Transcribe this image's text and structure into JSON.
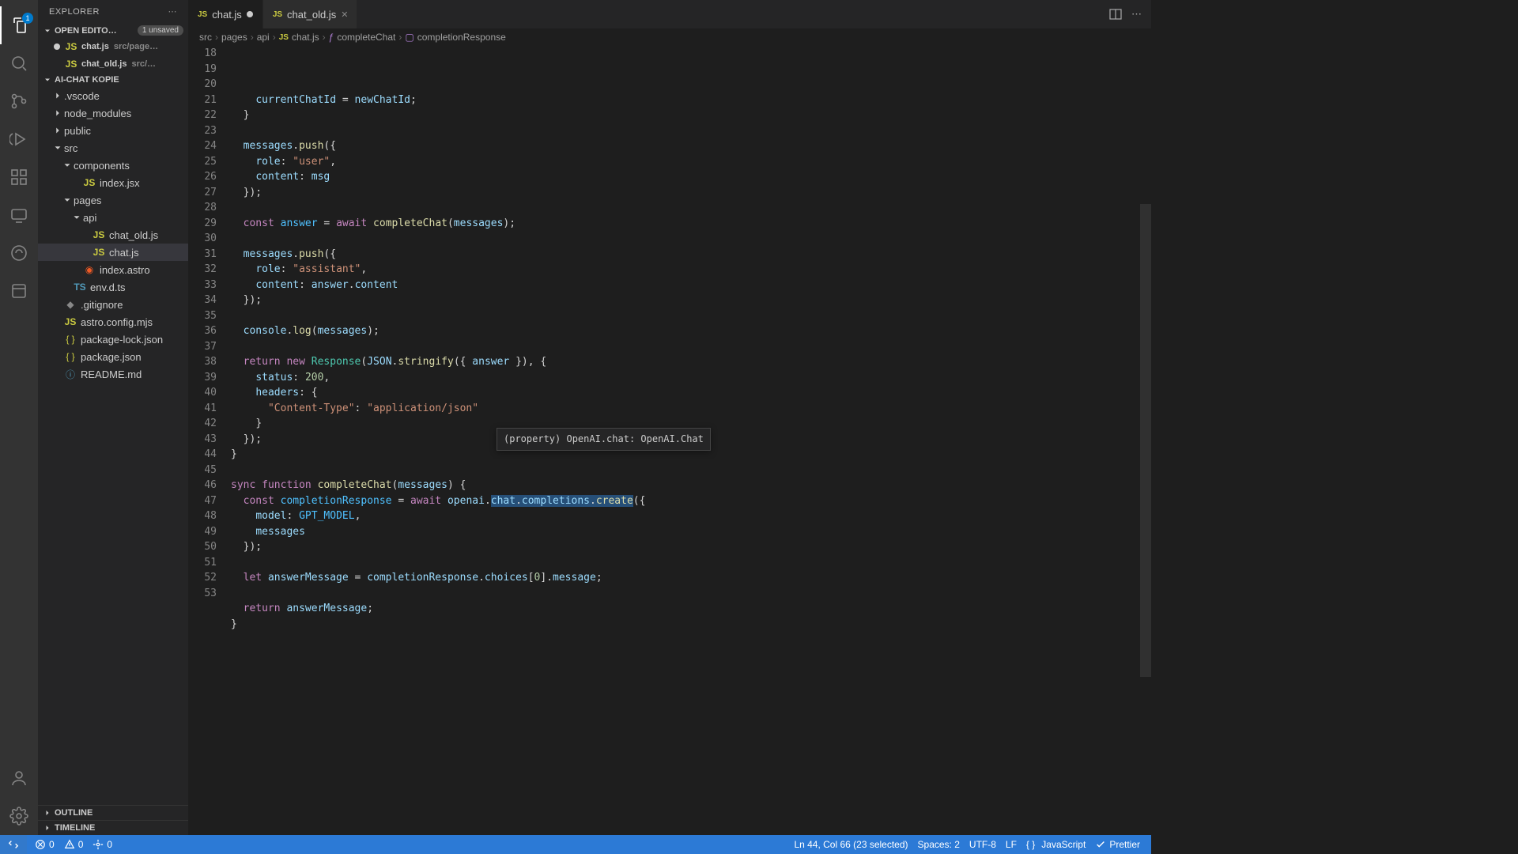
{
  "explorer": {
    "title": "EXPLORER",
    "openEditorsLabel": "OPEN EDITO…",
    "unsavedBadge": "1 unsaved",
    "openEditors": [
      {
        "name": "chat.js",
        "path": "src/page…",
        "dirty": true
      },
      {
        "name": "chat_old.js",
        "path": "src/…",
        "dirty": false
      }
    ],
    "workspaceLabel": "AI-CHAT KOPIE",
    "tree": [
      {
        "type": "folder",
        "name": ".vscode",
        "indent": 1,
        "expanded": false
      },
      {
        "type": "folder",
        "name": "node_modules",
        "indent": 1,
        "expanded": false
      },
      {
        "type": "folder",
        "name": "public",
        "indent": 1,
        "expanded": false
      },
      {
        "type": "folder",
        "name": "src",
        "indent": 1,
        "expanded": true
      },
      {
        "type": "folder",
        "name": "components",
        "indent": 2,
        "expanded": true
      },
      {
        "type": "file",
        "name": "index.jsx",
        "indent": 3,
        "icon": "js"
      },
      {
        "type": "folder",
        "name": "pages",
        "indent": 2,
        "expanded": true
      },
      {
        "type": "folder",
        "name": "api",
        "indent": 3,
        "expanded": true
      },
      {
        "type": "file",
        "name": "chat_old.js",
        "indent": 4,
        "icon": "js"
      },
      {
        "type": "file",
        "name": "chat.js",
        "indent": 4,
        "icon": "js",
        "selected": true
      },
      {
        "type": "file",
        "name": "index.astro",
        "indent": 3,
        "icon": "astro"
      },
      {
        "type": "file",
        "name": "env.d.ts",
        "indent": 2,
        "icon": "ts"
      },
      {
        "type": "file",
        "name": ".gitignore",
        "indent": 1,
        "icon": "git"
      },
      {
        "type": "file",
        "name": "astro.config.mjs",
        "indent": 1,
        "icon": "js"
      },
      {
        "type": "file",
        "name": "package-lock.json",
        "indent": 1,
        "icon": "json"
      },
      {
        "type": "file",
        "name": "package.json",
        "indent": 1,
        "icon": "json"
      },
      {
        "type": "file",
        "name": "README.md",
        "indent": 1,
        "icon": "info"
      }
    ],
    "outlineLabel": "OUTLINE",
    "timelineLabel": "TIMELINE"
  },
  "tabs": [
    {
      "name": "chat.js",
      "dirty": true,
      "active": true
    },
    {
      "name": "chat_old.js",
      "dirty": false,
      "active": false
    }
  ],
  "breadcrumbs": [
    "src",
    "pages",
    "api",
    "chat.js",
    "completeChat",
    "completionResponse"
  ],
  "hoverTooltip": "(property) OpenAI.chat: OpenAI.Chat",
  "code": {
    "startLine": 18,
    "lines": [
      {
        "n": 18,
        "html": "    <span class='k-var'>currentChatId</span> <span class='k-pun'>=</span> <span class='k-var'>newChatId</span><span class='k-pun'>;</span>"
      },
      {
        "n": 19,
        "html": "  <span class='k-pun'>}</span>"
      },
      {
        "n": 20,
        "html": ""
      },
      {
        "n": 21,
        "html": "  <span class='k-var'>messages</span><span class='k-pun'>.</span><span class='k-fn'>push</span><span class='k-pun'>({</span>"
      },
      {
        "n": 22,
        "html": "    <span class='k-prop'>role</span><span class='k-pun'>:</span> <span class='k-str'>\"user\"</span><span class='k-pun'>,</span>"
      },
      {
        "n": 23,
        "html": "    <span class='k-prop'>content</span><span class='k-pun'>:</span> <span class='k-var'>msg</span>"
      },
      {
        "n": 24,
        "html": "  <span class='k-pun'>});</span>"
      },
      {
        "n": 25,
        "html": ""
      },
      {
        "n": 26,
        "html": "  <span class='k-kw'>const</span> <span class='k-const'>answer</span> <span class='k-pun'>=</span> <span class='k-kw'>await</span> <span class='k-fn'>completeChat</span><span class='k-pun'>(</span><span class='k-var'>messages</span><span class='k-pun'>);</span>"
      },
      {
        "n": 27,
        "html": ""
      },
      {
        "n": 28,
        "html": "  <span class='k-var'>messages</span><span class='k-pun'>.</span><span class='k-fn'>push</span><span class='k-pun'>({</span>"
      },
      {
        "n": 29,
        "html": "    <span class='k-prop'>role</span><span class='k-pun'>:</span> <span class='k-str'>\"assistant\"</span><span class='k-pun'>,</span>"
      },
      {
        "n": 30,
        "html": "    <span class='k-prop'>content</span><span class='k-pun'>:</span> <span class='k-var'>answer</span><span class='k-pun'>.</span><span class='k-var'>content</span>"
      },
      {
        "n": 31,
        "html": "  <span class='k-pun'>});</span>"
      },
      {
        "n": 32,
        "html": ""
      },
      {
        "n": 33,
        "html": "  <span class='k-var'>console</span><span class='k-pun'>.</span><span class='k-fn'>log</span><span class='k-pun'>(</span><span class='k-var'>messages</span><span class='k-pun'>);</span>"
      },
      {
        "n": 34,
        "html": ""
      },
      {
        "n": 35,
        "html": "  <span class='k-kw'>return</span> <span class='k-kw'>new</span> <span class='k-type'>Response</span><span class='k-pun'>(</span><span class='k-var'>JSON</span><span class='k-pun'>.</span><span class='k-fn'>stringify</span><span class='k-pun'>({</span> <span class='k-var'>answer</span> <span class='k-pun'>}), {</span>"
      },
      {
        "n": 36,
        "html": "    <span class='k-prop'>status</span><span class='k-pun'>:</span> <span class='k-num'>200</span><span class='k-pun'>,</span>"
      },
      {
        "n": 37,
        "html": "    <span class='k-prop'>headers</span><span class='k-pun'>:</span> <span class='k-pun'>{</span>"
      },
      {
        "n": 38,
        "html": "      <span class='k-str'>\"Content-Type\"</span><span class='k-pun'>:</span> <span class='k-str'>\"application/json\"</span>"
      },
      {
        "n": 39,
        "html": "    <span class='k-pun'>}</span>"
      },
      {
        "n": 40,
        "html": "  <span class='k-pun'>});</span>"
      },
      {
        "n": 41,
        "html": "<span class='k-pun'>}</span>"
      },
      {
        "n": 42,
        "html": ""
      },
      {
        "n": 43,
        "html": "<span class='bulb'>💡</span><span class='k-kw'>sync</span> <span class='k-kw'>function</span> <span class='k-fn'>completeChat</span><span class='k-pun'>(</span><span class='k-var'>messages</span><span class='k-pun'>) {</span>"
      },
      {
        "n": 44,
        "html": "  <span class='k-kw'>const</span> <span class='k-const'>completionResponse</span> <span class='k-pun'>=</span> <span class='k-kw'>await</span> <span class='k-var'>openai</span><span class='k-pun'>.</span><span class='selection'><span class='k-var'>chat</span><span class='k-pun'>.</span><span class='k-var'>completions</span><span class='k-pun'>.</span><span class='k-fn'>create</span></span><span class='k-pun'>({</span>"
      },
      {
        "n": 45,
        "html": "    <span class='k-prop'>model</span><span class='k-pun'>:</span> <span class='k-const'>GPT_MODEL</span><span class='k-pun'>,</span>"
      },
      {
        "n": 46,
        "html": "    <span class='k-var'>messages</span>"
      },
      {
        "n": 47,
        "html": "  <span class='k-pun'>});</span>"
      },
      {
        "n": 48,
        "html": ""
      },
      {
        "n": 49,
        "html": "  <span class='k-kw'>let</span> <span class='k-var'>answerMessage</span> <span class='k-pun'>=</span> <span class='k-var'>completionResponse</span><span class='k-pun'>.</span><span class='k-var'>choices</span><span class='k-pun'>[</span><span class='k-num'>0</span><span class='k-pun'>].</span><span class='k-var'>message</span><span class='k-pun'>;</span>"
      },
      {
        "n": 50,
        "html": ""
      },
      {
        "n": 51,
        "html": "  <span class='k-kw'>return</span> <span class='k-var'>answerMessage</span><span class='k-pun'>;</span>"
      },
      {
        "n": 52,
        "html": "<span class='k-pun'>}</span>"
      },
      {
        "n": 53,
        "html": ""
      }
    ]
  },
  "statusBar": {
    "errors": "0",
    "warnings": "0",
    "ports": "0",
    "cursor": "Ln 44, Col 66 (23 selected)",
    "spaces": "Spaces: 2",
    "encoding": "UTF-8",
    "eol": "LF",
    "language": "JavaScript",
    "prettier": "Prettier"
  }
}
